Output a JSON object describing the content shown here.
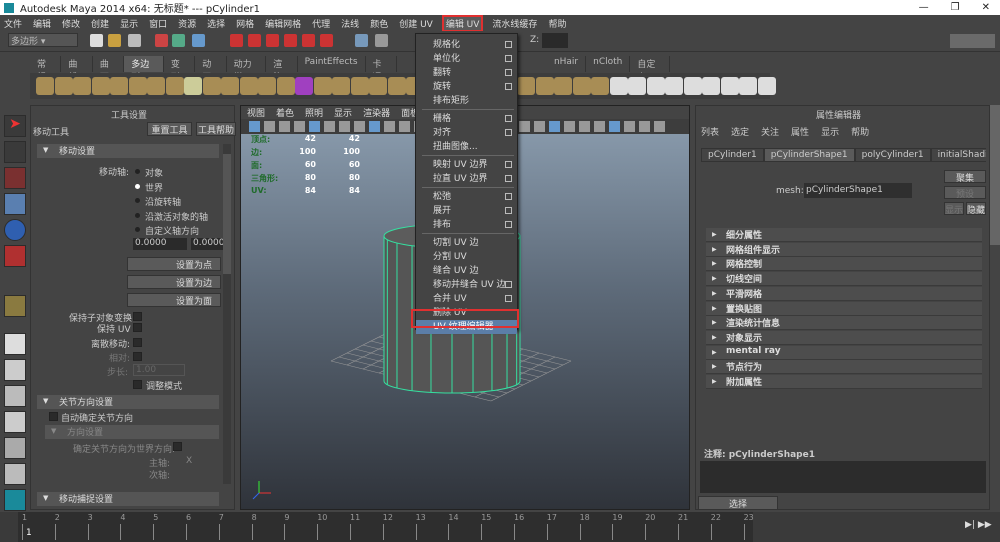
{
  "window": {
    "title": "Autodesk Maya 2014 x64: 无标题*   ---   pCylinder1",
    "controls": [
      "—",
      "❐",
      "✕"
    ]
  },
  "menubar": [
    "文件",
    "编辑",
    "修改",
    "创建",
    "显示",
    "窗口",
    "资源",
    "选择",
    "网格",
    "编辑网格",
    "代理",
    "法线",
    "颜色",
    "创建 UV",
    "编辑 UV",
    "流水线缓存",
    "帮助"
  ],
  "active_menu": "编辑 UV",
  "toolbar": {
    "mode": "多边形",
    "z_label": "Z:"
  },
  "shelf": {
    "tabs": [
      "常规",
      "曲线",
      "曲面",
      "多边形",
      "变形",
      "动画",
      "动力学",
      "渲染",
      "PaintEffects",
      "卡通",
      "nHair",
      "nCloth",
      "自定义"
    ],
    "active": "多边形"
  },
  "dropdown": {
    "items": [
      {
        "label": "规格化",
        "option": true
      },
      {
        "label": "单位化",
        "option": true
      },
      {
        "label": "翻转",
        "option": true
      },
      {
        "label": "旋转",
        "option": true
      },
      {
        "label": "排布矩形",
        "option": false
      },
      {
        "label": "栅格",
        "option": true
      },
      {
        "label": "对齐",
        "option": true
      },
      {
        "label": "扭曲图像...",
        "option": false
      },
      {
        "label": "映射 UV 边界",
        "option": true
      },
      {
        "label": "拉直 UV 边界",
        "option": true
      },
      {
        "label": "松弛",
        "option": true
      },
      {
        "label": "展开",
        "option": true
      },
      {
        "label": "排布",
        "option": true
      },
      {
        "label": "切割 UV 边",
        "option": false
      },
      {
        "label": "分割 UV",
        "option": false
      },
      {
        "label": "缝合 UV 边",
        "option": false
      },
      {
        "label": "移动并缝合 UV 边",
        "option": true
      },
      {
        "label": "合并 UV",
        "option": true
      },
      {
        "label": "删除 UV",
        "option": false
      },
      {
        "label": "UV 纹理编辑器",
        "option": false,
        "highlighted": true
      }
    ]
  },
  "tool_settings": {
    "title": "工具设置",
    "tool": "移动工具",
    "reset": "重置工具",
    "help": "工具帮助",
    "move_section": "移动设置",
    "axis_label": "移动轴:",
    "axes": [
      "对象",
      "世界",
      "沿旋转轴",
      "沿激活对象的轴",
      "自定义轴方向"
    ],
    "selected_axis": "世界",
    "custom_values": [
      "0.0000",
      "0.0000"
    ],
    "set_point": "设置为点",
    "set_edge": "设置为边",
    "set_face": "设置为面",
    "keep_child": "保持子对象变换",
    "keep_uv": "保持 UV",
    "discrete": "离散移动:",
    "relative": "相对:",
    "step": "步长:",
    "step_value": "1.00",
    "tweak": "调整模式",
    "joint_section": "关节方向设置",
    "auto_joint": "自动确定关节方向",
    "orient_section": "方向设置",
    "orient_world": "确定关节方向为世界方向:",
    "primary": "主轴:",
    "secondary": "次轴:",
    "axis_x": "X",
    "snap_section": "移动捕捉设置"
  },
  "viewport": {
    "menu": [
      "视图",
      "着色",
      "照明",
      "显示",
      "渲染器",
      "面板"
    ],
    "hud": [
      {
        "label": "顶点:",
        "a": "42",
        "b": "42"
      },
      {
        "label": "边:",
        "a": "100",
        "b": "100"
      },
      {
        "label": "面:",
        "a": "60",
        "b": "60"
      },
      {
        "label": "三角形:",
        "a": "80",
        "b": "80"
      },
      {
        "label": "UV:",
        "a": "84",
        "b": "84"
      }
    ]
  },
  "attribute_editor": {
    "title": "属性编辑器",
    "menu": [
      "列表",
      "选定",
      "关注",
      "属性",
      "显示",
      "帮助"
    ],
    "tabs": [
      "pCylinder1",
      "pCylinderShape1",
      "polyCylinder1",
      "initialShadingGr"
    ],
    "active_tab": "pCylinderShape1",
    "mesh_label": "mesh:",
    "mesh_value": "pCylinderShape1",
    "focus": "聚集",
    "preset": "预设",
    "show": "显示",
    "hide": "隐藏",
    "sections": [
      "细分属性",
      "网格组件显示",
      "网格控制",
      "切线空间",
      "平滑网格",
      "置换贴图",
      "渲染统计信息",
      "对象显示",
      "mental ray",
      "节点行为",
      "附加属性"
    ],
    "notes": "注释: pCylinderShape1",
    "select": "选择"
  },
  "timeline": {
    "ticks": [
      "1",
      "2",
      "3",
      "4",
      "5",
      "6",
      "7",
      "8",
      "9",
      "10",
      "11",
      "12",
      "13",
      "14",
      "15",
      "16",
      "17",
      "18",
      "19",
      "20",
      "21",
      "22",
      "23"
    ],
    "current": "1"
  },
  "colors": {
    "highlight": "#e03030",
    "menu_selected": "#5b7ea8",
    "wireframe": "#35e0a0"
  }
}
